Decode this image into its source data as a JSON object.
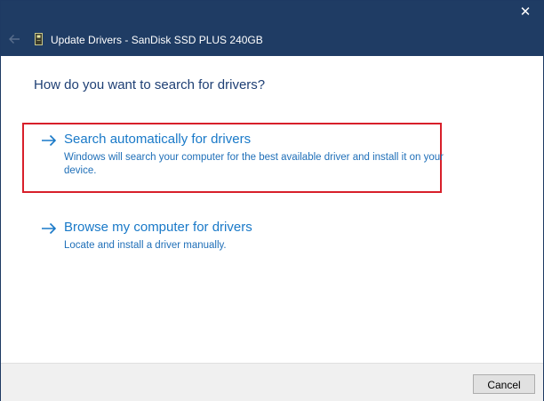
{
  "window": {
    "title": "Update Drivers - SanDisk SSD PLUS 240GB",
    "close_glyph": "✕",
    "titlebar_color": "#1f3c64",
    "icons": {
      "back": "back-arrow-icon",
      "drive": "drive-icon",
      "close": "close-icon"
    }
  },
  "main": {
    "heading": "How do you want to search for drivers?",
    "options": [
      {
        "title": "Search automatically for drivers",
        "description": "Windows will search your computer for the best available driver and install it on your device.",
        "highlighted": true,
        "icon": "arrow-right-icon"
      },
      {
        "title": "Browse my computer for drivers",
        "description": "Locate and install a driver manually.",
        "highlighted": false,
        "icon": "arrow-right-icon"
      }
    ],
    "link_color": "#1979c8",
    "highlight_color": "#d81f2a"
  },
  "footer": {
    "cancel_label": "Cancel"
  }
}
